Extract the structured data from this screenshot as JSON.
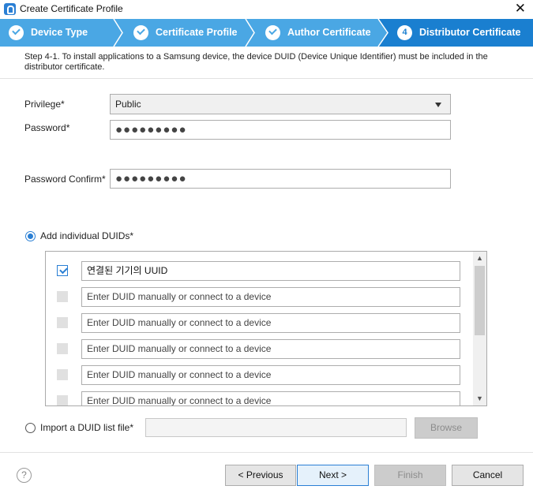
{
  "window": {
    "title": "Create Certificate Profile",
    "close_symbol": "✕"
  },
  "steps": [
    {
      "label": "Device Type",
      "status": "done"
    },
    {
      "label": "Certificate Profile",
      "status": "done"
    },
    {
      "label": "Author Certificate",
      "status": "done"
    },
    {
      "label": "Distributor Certificate",
      "number": "4",
      "status": "active"
    }
  ],
  "description": "Step 4-1. To install applications to a Samsung device, the device DUID (Device Unique Identifier) must be included in the distributor certificate.",
  "form": {
    "privilege_label": "Privilege*",
    "privilege_value": "Public",
    "password_label": "Password*",
    "password_value": "●●●●●●●●●",
    "confirm_label": "Password Confirm*",
    "confirm_value": "●●●●●●●●●"
  },
  "duid": {
    "option_individual_label": "Add individual DUIDs*",
    "option_individual_selected": true,
    "rows": [
      {
        "checked": true,
        "value": "연결된 기기의 UUID",
        "placeholder": ""
      },
      {
        "checked": false,
        "value": "",
        "placeholder": "Enter DUID manually or connect to a device"
      },
      {
        "checked": false,
        "value": "",
        "placeholder": "Enter DUID manually or connect to a device"
      },
      {
        "checked": false,
        "value": "",
        "placeholder": "Enter DUID manually or connect to a device"
      },
      {
        "checked": false,
        "value": "",
        "placeholder": "Enter DUID manually or connect to a device"
      },
      {
        "checked": false,
        "value": "",
        "placeholder": "Enter DUID manually or connect to a device"
      }
    ],
    "option_import_label": "Import a DUID list file*",
    "option_import_selected": false,
    "browse_label": "Browse"
  },
  "footer": {
    "help_symbol": "?",
    "previous_label": "< Previous",
    "next_label": "Next >",
    "finish_label": "Finish",
    "cancel_label": "Cancel"
  },
  "colors": {
    "step_bar": "#4aa7e4",
    "step_active": "#1a7fd0",
    "accent": "#2a7fd4"
  }
}
